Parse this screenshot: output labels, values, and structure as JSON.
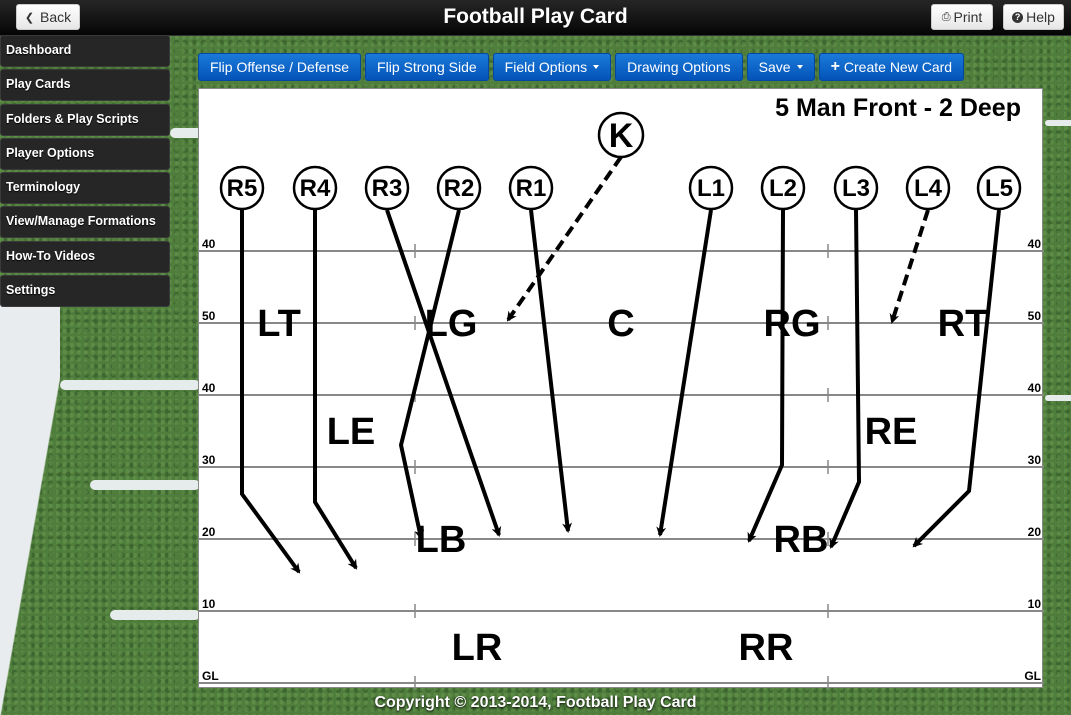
{
  "header": {
    "title": "Football Play Card",
    "back_label": "Back",
    "print_label": "Print",
    "help_label": "Help"
  },
  "sidebar": {
    "items": [
      {
        "label": "Dashboard"
      },
      {
        "label": "Play Cards"
      },
      {
        "label": "Folders & Play Scripts"
      },
      {
        "label": "Player Options"
      },
      {
        "label": "Terminology"
      },
      {
        "label": "View/Manage Formations"
      },
      {
        "label": "How-To Videos"
      },
      {
        "label": "Settings"
      }
    ]
  },
  "toolbar": {
    "flip_offense_defense": "Flip Offense / Defense",
    "flip_strong_side": "Flip Strong Side",
    "field_options": "Field Options",
    "drawing_options": "Drawing Options",
    "save": "Save",
    "create_new_card": "Create New Card"
  },
  "card": {
    "title": "5 Man Front - 2 Deep",
    "yard_labels": [
      "40",
      "50",
      "40",
      "30",
      "20",
      "10",
      "GL"
    ],
    "players": [
      {
        "id": "R5",
        "col": 0
      },
      {
        "id": "R4",
        "col": 1
      },
      {
        "id": "R3",
        "col": 2
      },
      {
        "id": "R2",
        "col": 3
      },
      {
        "id": "R1",
        "col": 4
      },
      {
        "id": "L1",
        "col": 5
      },
      {
        "id": "L2",
        "col": 6
      },
      {
        "id": "L3",
        "col": 7
      },
      {
        "id": "L4",
        "col": 8
      },
      {
        "id": "L5",
        "col": 9
      },
      {
        "id": "K",
        "col": "kicker"
      }
    ],
    "positions": [
      "LT",
      "LG",
      "C",
      "RG",
      "RT",
      "LE",
      "RE",
      "LB",
      "RB",
      "LR",
      "RR"
    ]
  },
  "footer": {
    "copyright": "Copyright © 2013-2014, Football Play Card"
  }
}
